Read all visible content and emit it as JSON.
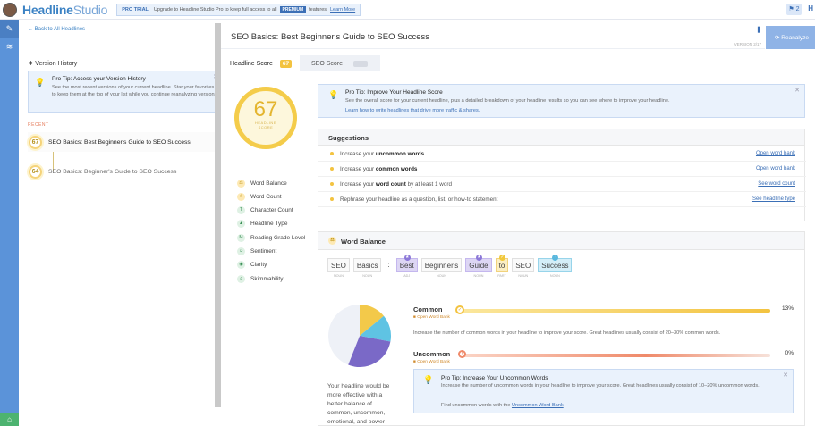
{
  "topbar": {
    "logo_main": "Headline",
    "logo_accent": "Studio",
    "trial": "PRO TRIAL",
    "promo_text": "Upgrade to Headline Studio Pro to keep full access to all",
    "premium": "PREMIUM",
    "features": "features",
    "learn": "Learn More",
    "notif": "2",
    "edge": "H"
  },
  "left": {
    "back": "Back to All Headlines",
    "version_history": "Version History",
    "tip": {
      "title": "Pro Tip: Access your Version History",
      "body": "See the most recent versions of your current headline. Star your favorites to keep them at the top of your list while you continue reanalyzing versions."
    },
    "recent": "RECENT",
    "history": [
      {
        "score": "67",
        "title": "SEO Basics: Best Beginner's Guide to SEO Success"
      },
      {
        "score": "64",
        "title": "SEO Basics: Beginner's Guide to SEO Success"
      }
    ]
  },
  "main": {
    "title": "SEO Basics: Best Beginner's Guide to SEO Success",
    "version": "VERSION 2/17",
    "reanalyze": "Reanalyze",
    "tabs": [
      {
        "label": "Headline Score",
        "badge": "67"
      },
      {
        "label": "SEO Score",
        "badge": ""
      }
    ],
    "gauge": {
      "score": "67",
      "label": "HEADLINE SCORE"
    },
    "score_nav": [
      {
        "label": "Word Balance",
        "icon": "scale-icon"
      },
      {
        "label": "Word Count",
        "icon": "count-icon"
      },
      {
        "label": "Character Count",
        "icon": "text-icon"
      },
      {
        "label": "Headline Type",
        "icon": "shapes-icon"
      },
      {
        "label": "Reading Grade Level",
        "icon": "grade-icon"
      },
      {
        "label": "Sentiment",
        "icon": "smile-icon"
      },
      {
        "label": "Clarity",
        "icon": "eye-icon"
      },
      {
        "label": "Skimmability",
        "icon": "magnify-icon"
      }
    ],
    "tip": {
      "title": "Pro Tip: Improve Your Headline Score",
      "body": "See the overall score for your current headline, plus a detailed breakdown of your headline results so you can see where to improve your headline.",
      "link": "Learn how to write headlines that drive more traffic & shares."
    },
    "suggestions": {
      "header": "Suggestions",
      "rows": [
        {
          "pre": "Increase your ",
          "bold": "uncommon words",
          "post": "",
          "link": "Open word bank"
        },
        {
          "pre": "Increase your ",
          "bold": "common words",
          "post": "",
          "link": "Open word bank"
        },
        {
          "pre": "Increase your ",
          "bold": "word count",
          "post": " by at least 1 word",
          "link": "See word count"
        },
        {
          "pre": "Rephrase your headline as a question, list, or how-to statement",
          "bold": "",
          "post": "",
          "link": "See headline type"
        }
      ]
    },
    "word_balance": {
      "header": "Word Balance",
      "words": [
        {
          "w": "SEO",
          "pos": "NOUN",
          "hl": "",
          "badge": ""
        },
        {
          "w": "Basics",
          "pos": "NOUN",
          "hl": "",
          "badge": ""
        },
        {
          "w": ":",
          "pos": "",
          "hl": "",
          "badge": ""
        },
        {
          "w": "Best",
          "pos": "ADJ",
          "hl": "p",
          "badge": "★"
        },
        {
          "w": "Beginner's",
          "pos": "NOUN",
          "hl": "",
          "badge": ""
        },
        {
          "w": "Guide",
          "pos": "NOUN",
          "hl": "p",
          "badge": "★"
        },
        {
          "w": "to",
          "pos": "PART",
          "hl": "y",
          "badge": "✓"
        },
        {
          "w": "SEO",
          "pos": "NOUN",
          "hl": "",
          "badge": ""
        },
        {
          "w": "Success",
          "pos": "NOUN",
          "hl": "b",
          "badge": "◔"
        }
      ],
      "pie": [
        {
          "label": "common",
          "value": 0.14,
          "color": "#f3c94a"
        },
        {
          "label": "uncommon",
          "value": 0.14,
          "color": "#5fc3e3"
        },
        {
          "label": "emotional",
          "value": 0.28,
          "color": "#7a69c7"
        },
        {
          "label": "neutral",
          "value": 0.44,
          "color": "#eef1f7"
        }
      ],
      "summary": "Your headline would be more effective with a better balance of common, uncommon, emotional, and power words.",
      "common": {
        "label": "Common",
        "link": "Open Word Bank",
        "pct": "13%",
        "value": 0.13,
        "color": "#f3c340",
        "desc": "Increase the number of common words in your headline to improve your score. Great headlines usually consist of 20–30% common words."
      },
      "uncommon": {
        "label": "Uncommon",
        "link": "Open Word Bank",
        "pct": "0%",
        "value": 0,
        "color": "#ef8a6a"
      },
      "tip": {
        "title": "Pro Tip: Increase Your Uncommon Words",
        "body": "Increase the number of uncommon words in your headline to improve your score. Great headlines usually consist of 10–20% uncommon words.",
        "link_pre": "Find uncommon words with the ",
        "link": "Uncommon Word Bank"
      }
    }
  }
}
